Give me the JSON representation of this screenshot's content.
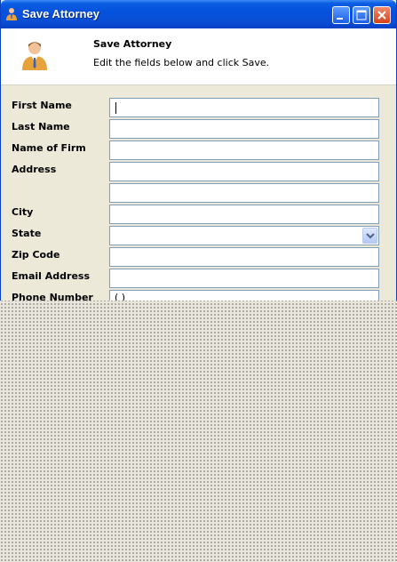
{
  "window": {
    "title": "Save Attorney",
    "controls": [
      "minimize-icon",
      "maximize-icon",
      "close-icon"
    ]
  },
  "header": {
    "title": "Save Attorney",
    "subtitle": "Edit the fields below and click Save.",
    "icon": "attorney-user-icon"
  },
  "form": {
    "first_name": {
      "label": "First Name",
      "value": ""
    },
    "last_name": {
      "label": "Last Name",
      "value": ""
    },
    "firm": {
      "label": "Name of Firm",
      "value": ""
    },
    "address": {
      "label": "Address",
      "line1": "",
      "line2": ""
    },
    "city": {
      "label": "City",
      "value": ""
    },
    "state": {
      "label": "State",
      "value": ""
    },
    "zip": {
      "label": "Zip Code",
      "value": ""
    },
    "email": {
      "label": "Email Address",
      "value": ""
    },
    "phone": {
      "label": "Phone Number",
      "value": "(   )"
    }
  },
  "colors": {
    "titlebar": "#0552dd",
    "dialog_bg": "#ece9d8",
    "input_border": "#7f9db9"
  }
}
